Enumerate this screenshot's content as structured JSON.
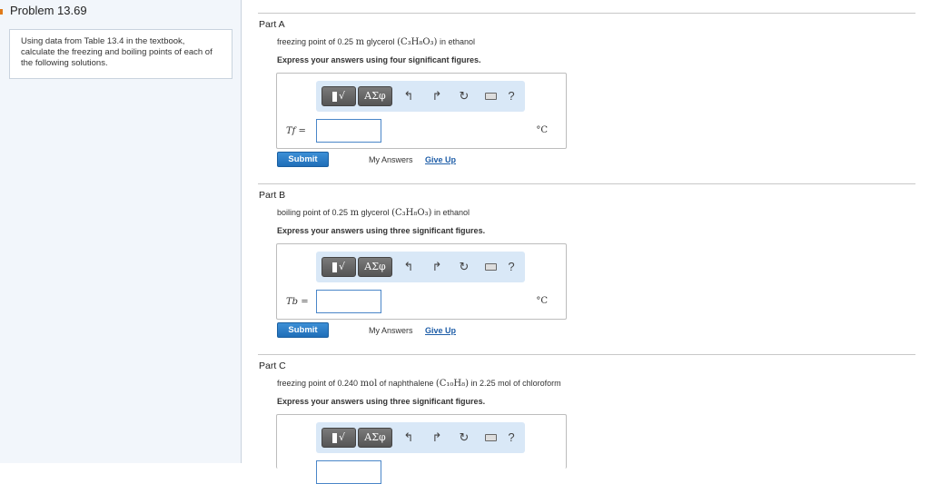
{
  "problem": {
    "title": "Problem 13.69",
    "intro": "Using data from Table 13.4 in the textbook, calculate the freezing and boiling points of each of the following solutions."
  },
  "toolbar": {
    "template_label": "√",
    "greek_label": "ΑΣφ",
    "undo_icon": "↰",
    "redo_icon": "↱",
    "reset_icon": "↻",
    "help_label": "?"
  },
  "submit_label": "Submit",
  "my_answers_label": "My Answers",
  "give_up_label": "Give Up",
  "parts": [
    {
      "label": "Part A",
      "q_pre": "freezing point of 0.25 ",
      "q_unit": "m",
      "q_mid": " glycerol ",
      "q_formula": "(C₃H₈O₃)",
      "q_post": " in ethanol",
      "instruction": "Express your answers using four significant figures.",
      "var": "Tf =",
      "answer": "",
      "unit": "°C"
    },
    {
      "label": "Part B",
      "q_pre": "boiling point of 0.25 ",
      "q_unit": "m",
      "q_mid": " glycerol ",
      "q_formula": "(C₃H₈O₃)",
      "q_post": " in ethanol",
      "instruction": "Express your answers using three significant figures.",
      "var": "Tb =",
      "answer": "",
      "unit": "°C"
    },
    {
      "label": "Part C",
      "q_pre": "freezing point of 0.240 ",
      "q_unit": "mol",
      "q_mid": " of naphthalene ",
      "q_formula": "(C₁₀H₈)",
      "q_post": " in 2.25 mol of chloroform",
      "instruction": "Express your answers using three significant figures."
    }
  ]
}
